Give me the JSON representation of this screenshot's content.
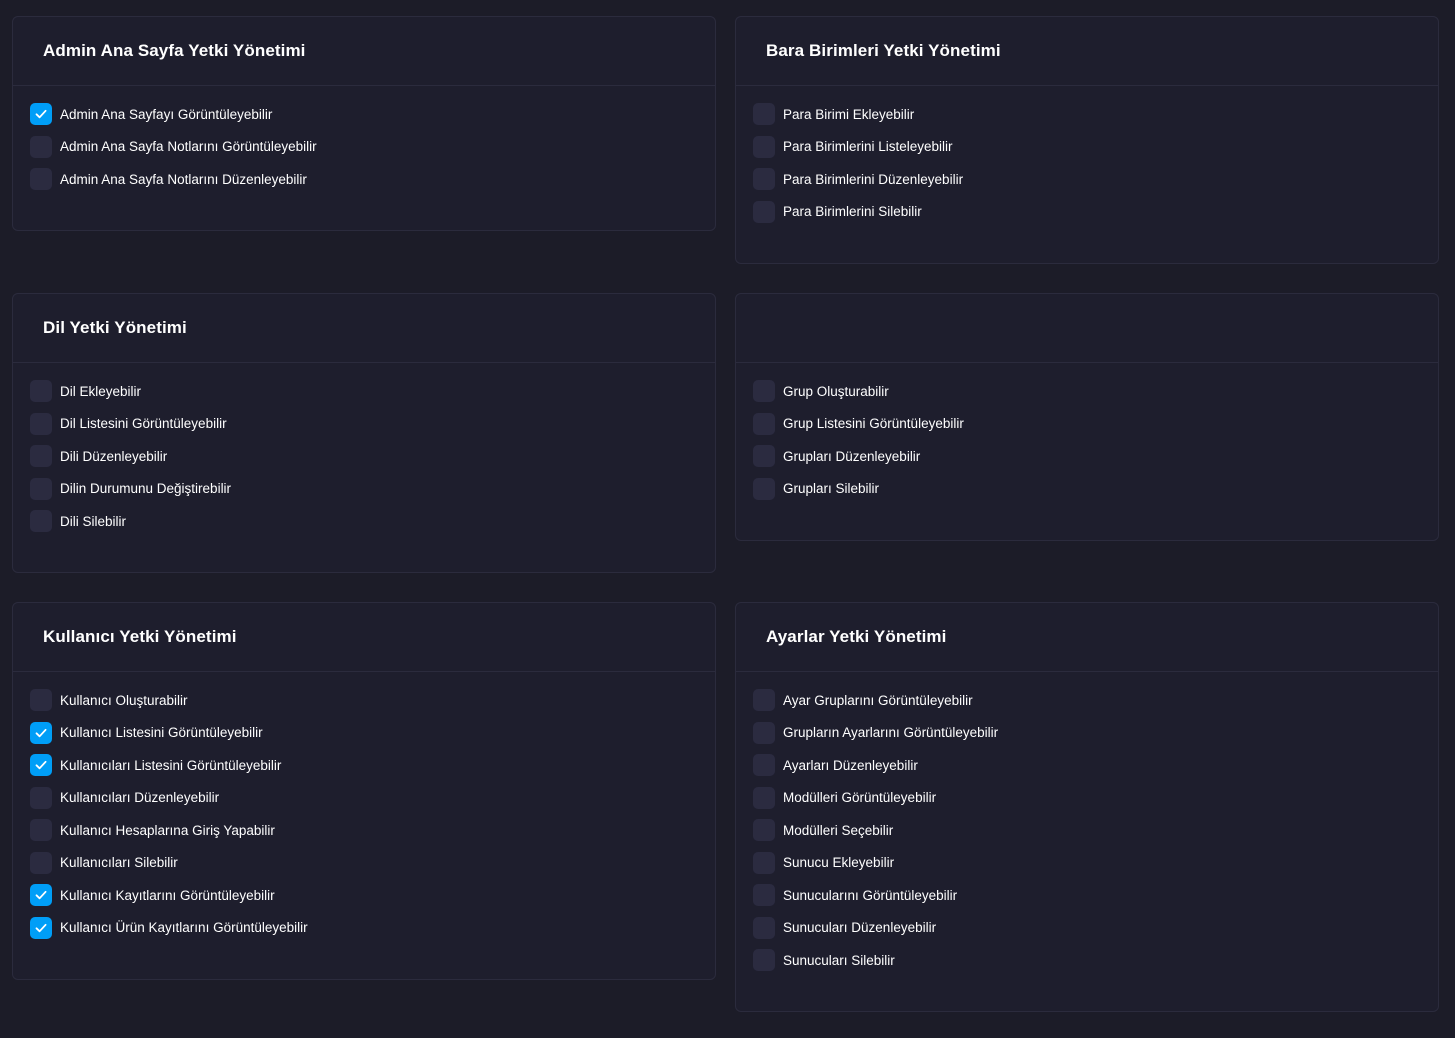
{
  "cards": [
    {
      "title": "Admin Ana Sayfa Yetki Yönetimi",
      "items": [
        {
          "label": "Admin Ana Sayfayı Görüntüleyebilir",
          "checked": true
        },
        {
          "label": "Admin Ana Sayfa Notlarını Görüntüleyebilir",
          "checked": false
        },
        {
          "label": "Admin Ana Sayfa Notlarını Düzenleyebilir",
          "checked": false
        }
      ]
    },
    {
      "title": "Bara Birimleri Yetki Yönetimi",
      "items": [
        {
          "label": "Para Birimi Ekleyebilir",
          "checked": false
        },
        {
          "label": "Para Birimlerini Listeleyebilir",
          "checked": false
        },
        {
          "label": "Para Birimlerini Düzenleyebilir",
          "checked": false
        },
        {
          "label": "Para Birimlerini Silebilir",
          "checked": false
        }
      ]
    },
    {
      "title": "Dil Yetki Yönetimi",
      "items": [
        {
          "label": "Dil Ekleyebilir",
          "checked": false
        },
        {
          "label": "Dil Listesini Görüntüleyebilir",
          "checked": false
        },
        {
          "label": "Dili Düzenleyebilir",
          "checked": false
        },
        {
          "label": "Dilin Durumunu Değiştirebilir",
          "checked": false
        },
        {
          "label": "Dili Silebilir",
          "checked": false
        }
      ]
    },
    {
      "title": "",
      "items": [
        {
          "label": "Grup Oluşturabilir",
          "checked": false
        },
        {
          "label": "Grup Listesini Görüntüleyebilir",
          "checked": false
        },
        {
          "label": "Grupları Düzenleyebilir",
          "checked": false
        },
        {
          "label": "Grupları Silebilir",
          "checked": false
        }
      ]
    },
    {
      "title": "Kullanıcı Yetki Yönetimi",
      "items": [
        {
          "label": "Kullanıcı Oluşturabilir",
          "checked": false
        },
        {
          "label": "Kullanıcı Listesini Görüntüleyebilir",
          "checked": true
        },
        {
          "label": "Kullanıcıları Listesini Görüntüleyebilir",
          "checked": true
        },
        {
          "label": "Kullanıcıları Düzenleyebilir",
          "checked": false
        },
        {
          "label": "Kullanıcı Hesaplarına Giriş Yapabilir",
          "checked": false
        },
        {
          "label": "Kullanıcıları Silebilir",
          "checked": false
        },
        {
          "label": "Kullanıcı Kayıtlarını Görüntüleyebilir",
          "checked": true
        },
        {
          "label": "Kullanıcı Ürün Kayıtlarını Görüntüleyebilir",
          "checked": true
        }
      ]
    },
    {
      "title": "Ayarlar Yetki Yönetimi",
      "items": [
        {
          "label": "Ayar Gruplarını Görüntüleyebilir",
          "checked": false
        },
        {
          "label": "Grupların Ayarlarını Görüntüleyebilir",
          "checked": false
        },
        {
          "label": "Ayarları Düzenleyebilir",
          "checked": false
        },
        {
          "label": "Modülleri Görüntüleyebilir",
          "checked": false
        },
        {
          "label": "Modülleri Seçebilir",
          "checked": false
        },
        {
          "label": "Sunucu Ekleyebilir",
          "checked": false
        },
        {
          "label": "Sunucularını Görüntüleyebilir",
          "checked": false
        },
        {
          "label": "Sunucuları Düzenleyebilir",
          "checked": false
        },
        {
          "label": "Sunucuları Silebilir",
          "checked": false
        }
      ]
    }
  ],
  "colors": {
    "page_bg": "#1c1c28",
    "card_bg": "#1e1e2d",
    "card_border": "#2b2b3d",
    "checkbox_off": "#2b2b40",
    "checkbox_on": "#009ef7"
  }
}
